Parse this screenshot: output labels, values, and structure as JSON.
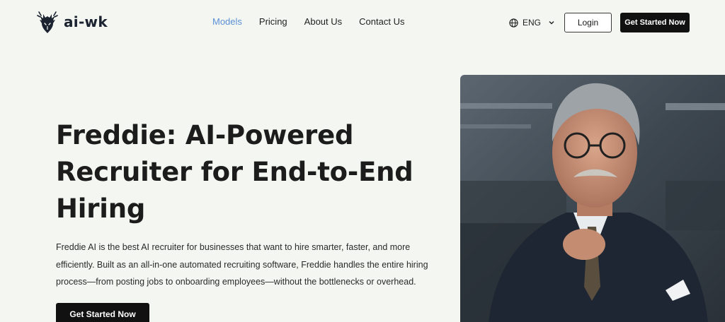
{
  "brand": {
    "name": "ai-wk",
    "logo_icon": "deer-head-icon"
  },
  "nav": {
    "items": [
      {
        "label": "Models",
        "active": true
      },
      {
        "label": "Pricing",
        "active": false
      },
      {
        "label": "About Us",
        "active": false
      },
      {
        "label": "Contact Us",
        "active": false
      }
    ]
  },
  "header": {
    "language": "ENG",
    "login_label": "Login",
    "cta_label": "Get Started Now"
  },
  "hero": {
    "title_lines": [
      "Freddie: AI-Powered",
      "Recruiter for End-to-End",
      "Hiring"
    ],
    "description_lines": [
      "Freddie AI is the best AI recruiter for businesses that want to hire smarter, faster, and more",
      "efficiently. Built as an all-in-one automated recruiting software, Freddie handles the entire hiring",
      "process—from posting jobs to onboarding employees—without the bottlenecks or overhead."
    ],
    "cta_label": "Get Started Now",
    "image": "portrait-of-older-businessman-in-office"
  },
  "colors": {
    "background": "#f4f7f1",
    "nav_active": "#5b8fd6",
    "cta": "#111111"
  }
}
